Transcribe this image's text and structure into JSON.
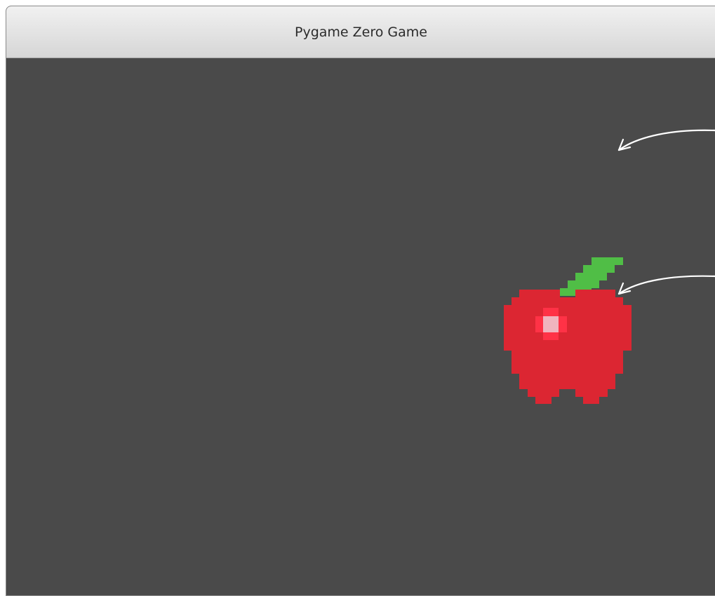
{
  "window": {
    "title": "Pygame Zero Game"
  },
  "game": {
    "background_color": "#4a4a4a",
    "sprite": {
      "name": "apple",
      "colors": {
        "body": "#dc2632",
        "highlight_outer": "#ff3246",
        "highlight_inner": "#f0b4be",
        "leaf": "#50be46"
      }
    }
  },
  "annotations": {
    "arrow_color": "#ffffff"
  }
}
